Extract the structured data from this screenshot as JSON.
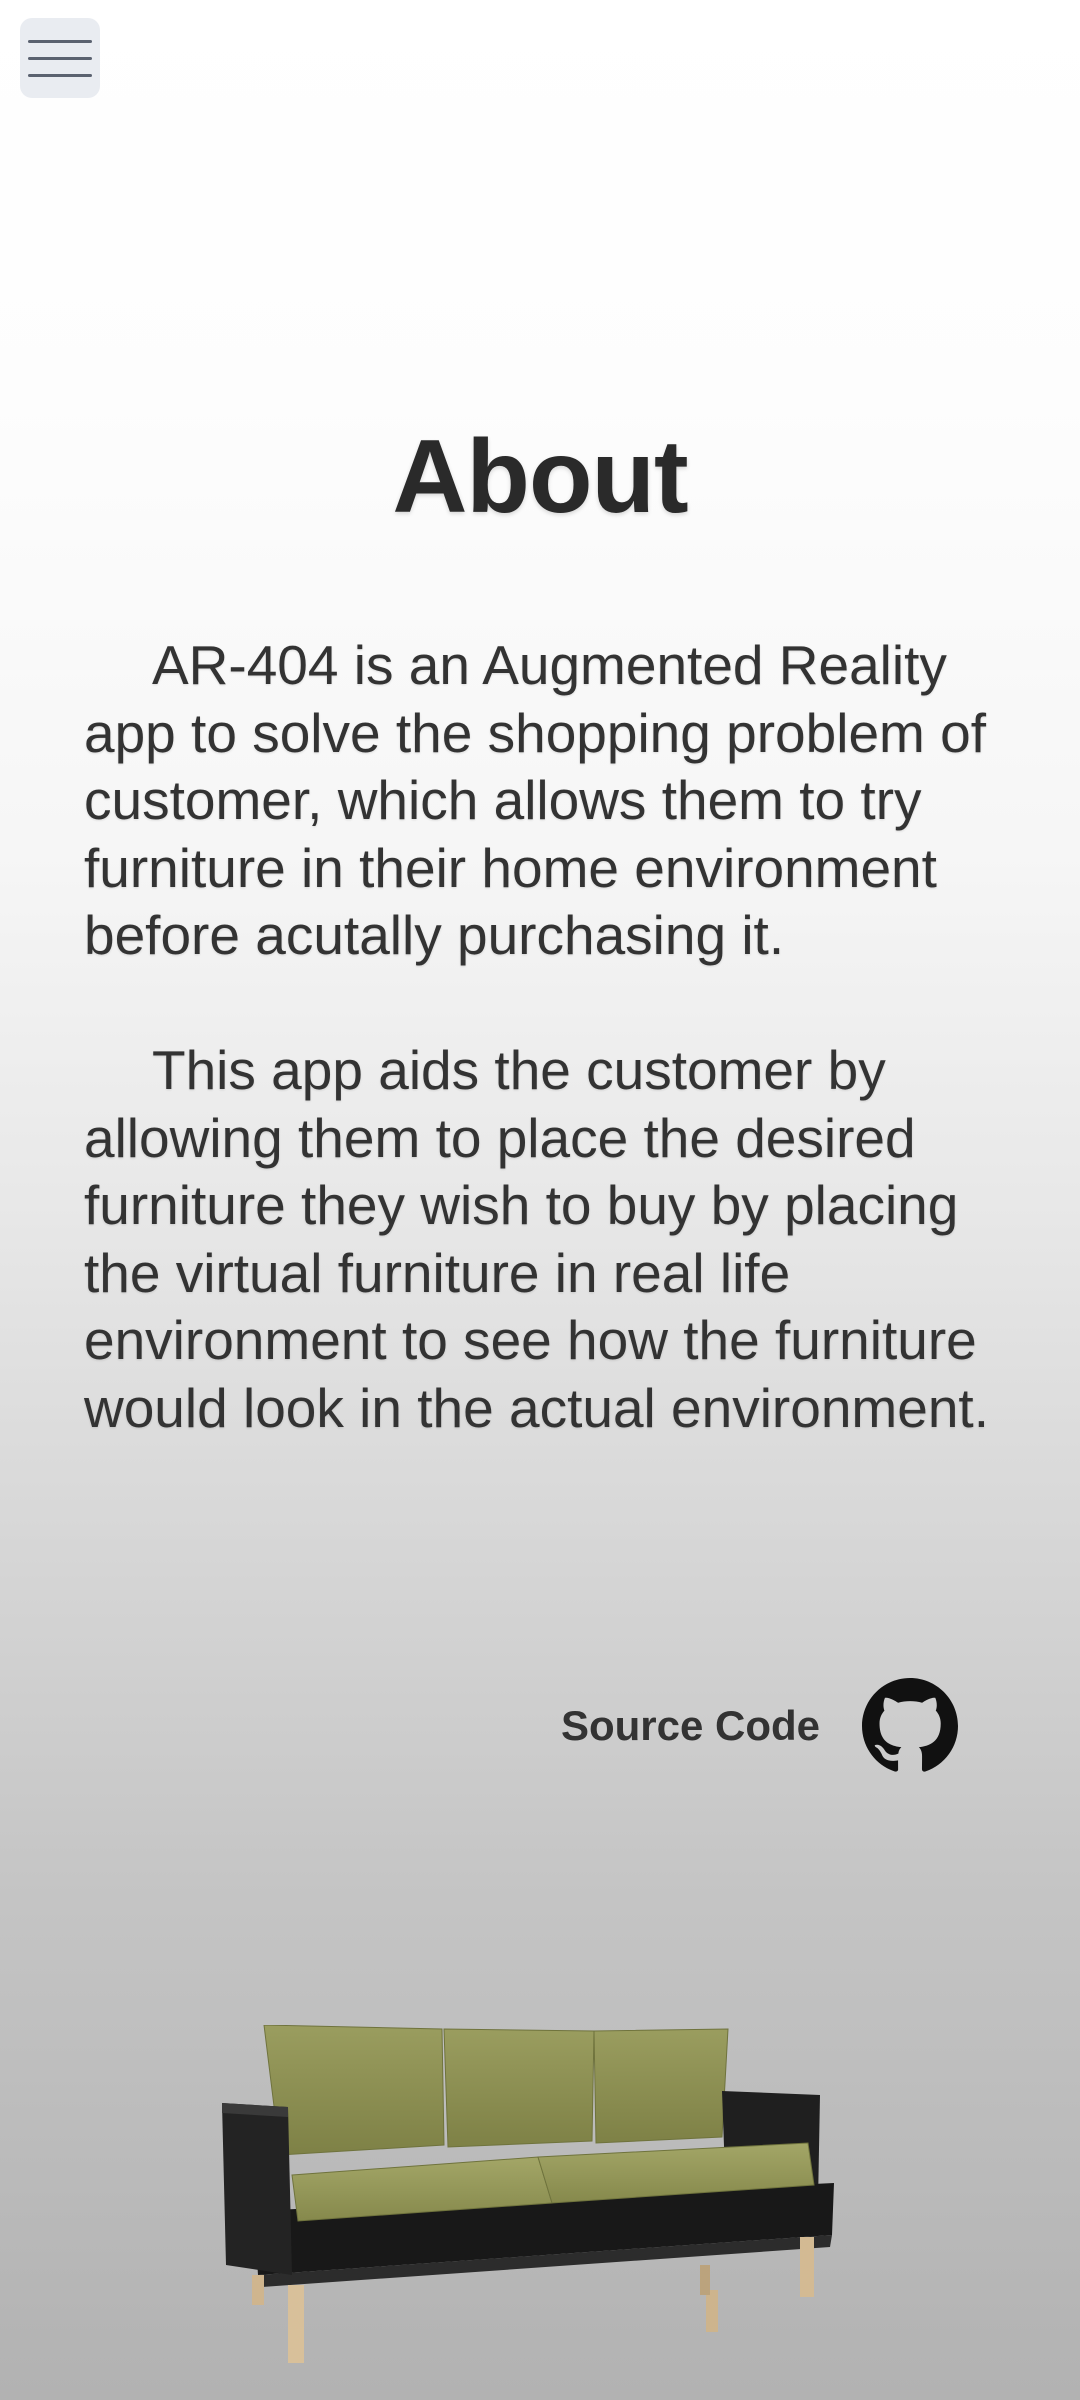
{
  "header": {
    "menu_icon": "hamburger-menu-icon"
  },
  "page": {
    "title": "About"
  },
  "about": {
    "paragraph_1": "AR-404 is an Augmented Reality app  to solve the shopping problem of customer, which allows them to try furniture in their home environment before acutally purchasing it.",
    "paragraph_2": "This app aids the customer by allowing them to place the desired furniture they wish to buy by placing the virtual furniture in real life environment  to see how the furniture would look in the actual environment."
  },
  "source": {
    "label": "Source Code",
    "icon": "github-icon"
  },
  "illustration": {
    "name": "sofa-model",
    "colors": {
      "cushion": "#8e9154",
      "frame": "#1c1c1c",
      "legs": "#d8c09a"
    }
  }
}
